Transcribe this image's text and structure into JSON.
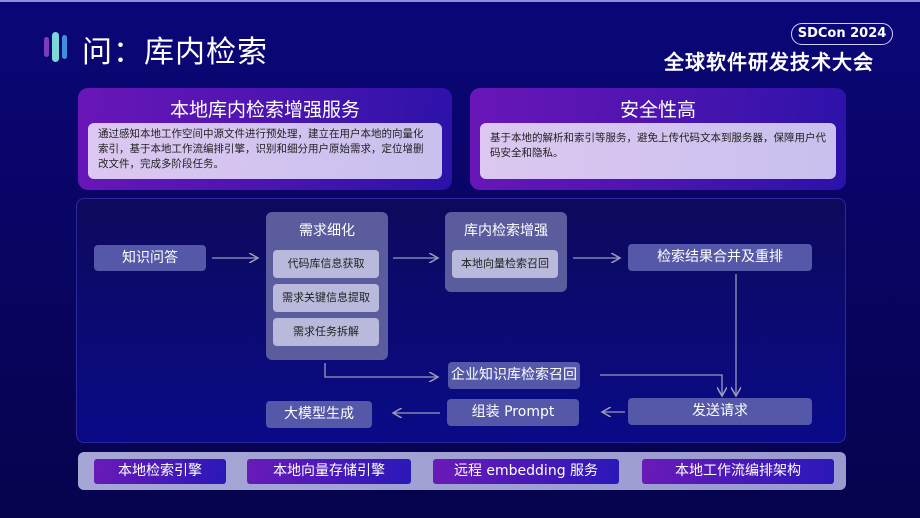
{
  "header": {
    "title": "问：库内检索",
    "event_badge": "SDCon 2024",
    "event_name": "全球软件研发技术大会"
  },
  "cards": [
    {
      "title": "本地库内检索增强服务",
      "body": "通过感知本地工作空间中源文件进行预处理，建立在用户本地的向量化索引，基于本地工作流编排引擎，识别和细分用户原始需求，定位增删改文件，完成多阶段任务。"
    },
    {
      "title": "安全性高",
      "body": "基于本地的解析和索引等服务，避免上传代码文本到服务器，保障用户代码安全和隐私。"
    }
  ],
  "flow": {
    "knowledge_qa": "知识问答",
    "refine": {
      "title": "需求细化",
      "items": [
        "代码库信息获取",
        "需求关键信息提取",
        "需求任务拆解"
      ]
    },
    "retrieval": {
      "title": "库内检索增强",
      "items": [
        "本地向量检索召回"
      ]
    },
    "merge_rerank": "检索结果合并及重排",
    "enterprise_recall": "企业知识库检索召回",
    "send_request": "发送请求",
    "assemble_prompt": "组装 Prompt",
    "llm_generate": "大模型生成"
  },
  "bottom_bar": [
    "本地检索引擎",
    "本地向量存储引擎",
    "远程 embedding 服务",
    "本地工作流编排架构"
  ]
}
